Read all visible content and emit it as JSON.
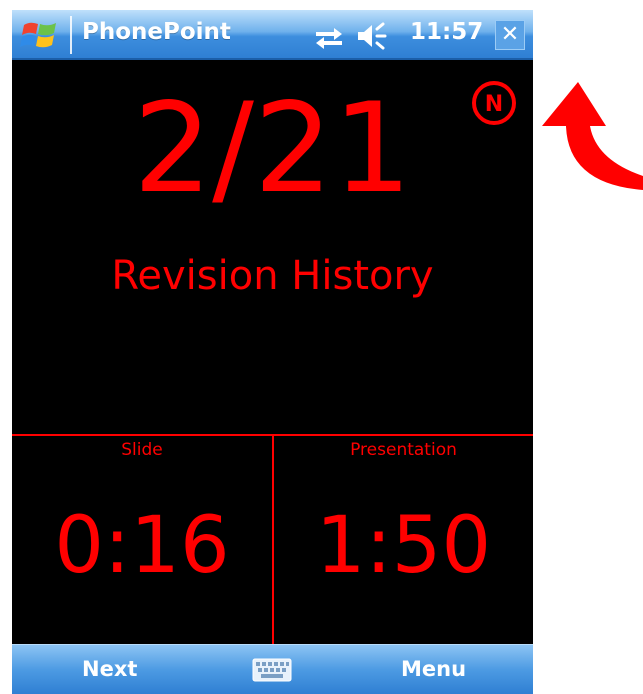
{
  "titlebar": {
    "app_title": "PhonePoint",
    "time": "11:57",
    "start_icon": "windows-flag-icon",
    "connectivity_icon": "connectivity-arrows-icon",
    "volume_icon": "speaker-volume-icon",
    "close_label": "✕"
  },
  "slide": {
    "counter": "2/21",
    "title": "Revision History",
    "badge_letter": "N"
  },
  "timers": {
    "slide_label": "Slide",
    "slide_time": "0:16",
    "presentation_label": "Presentation",
    "presentation_time": "1:50"
  },
  "softkeys": {
    "left": "Next",
    "right": "Menu",
    "center_icon": "keyboard-icon"
  },
  "colors": {
    "accent": "#ff0000",
    "screen_bg": "#000000",
    "bar_blue": "#3d8ede"
  }
}
